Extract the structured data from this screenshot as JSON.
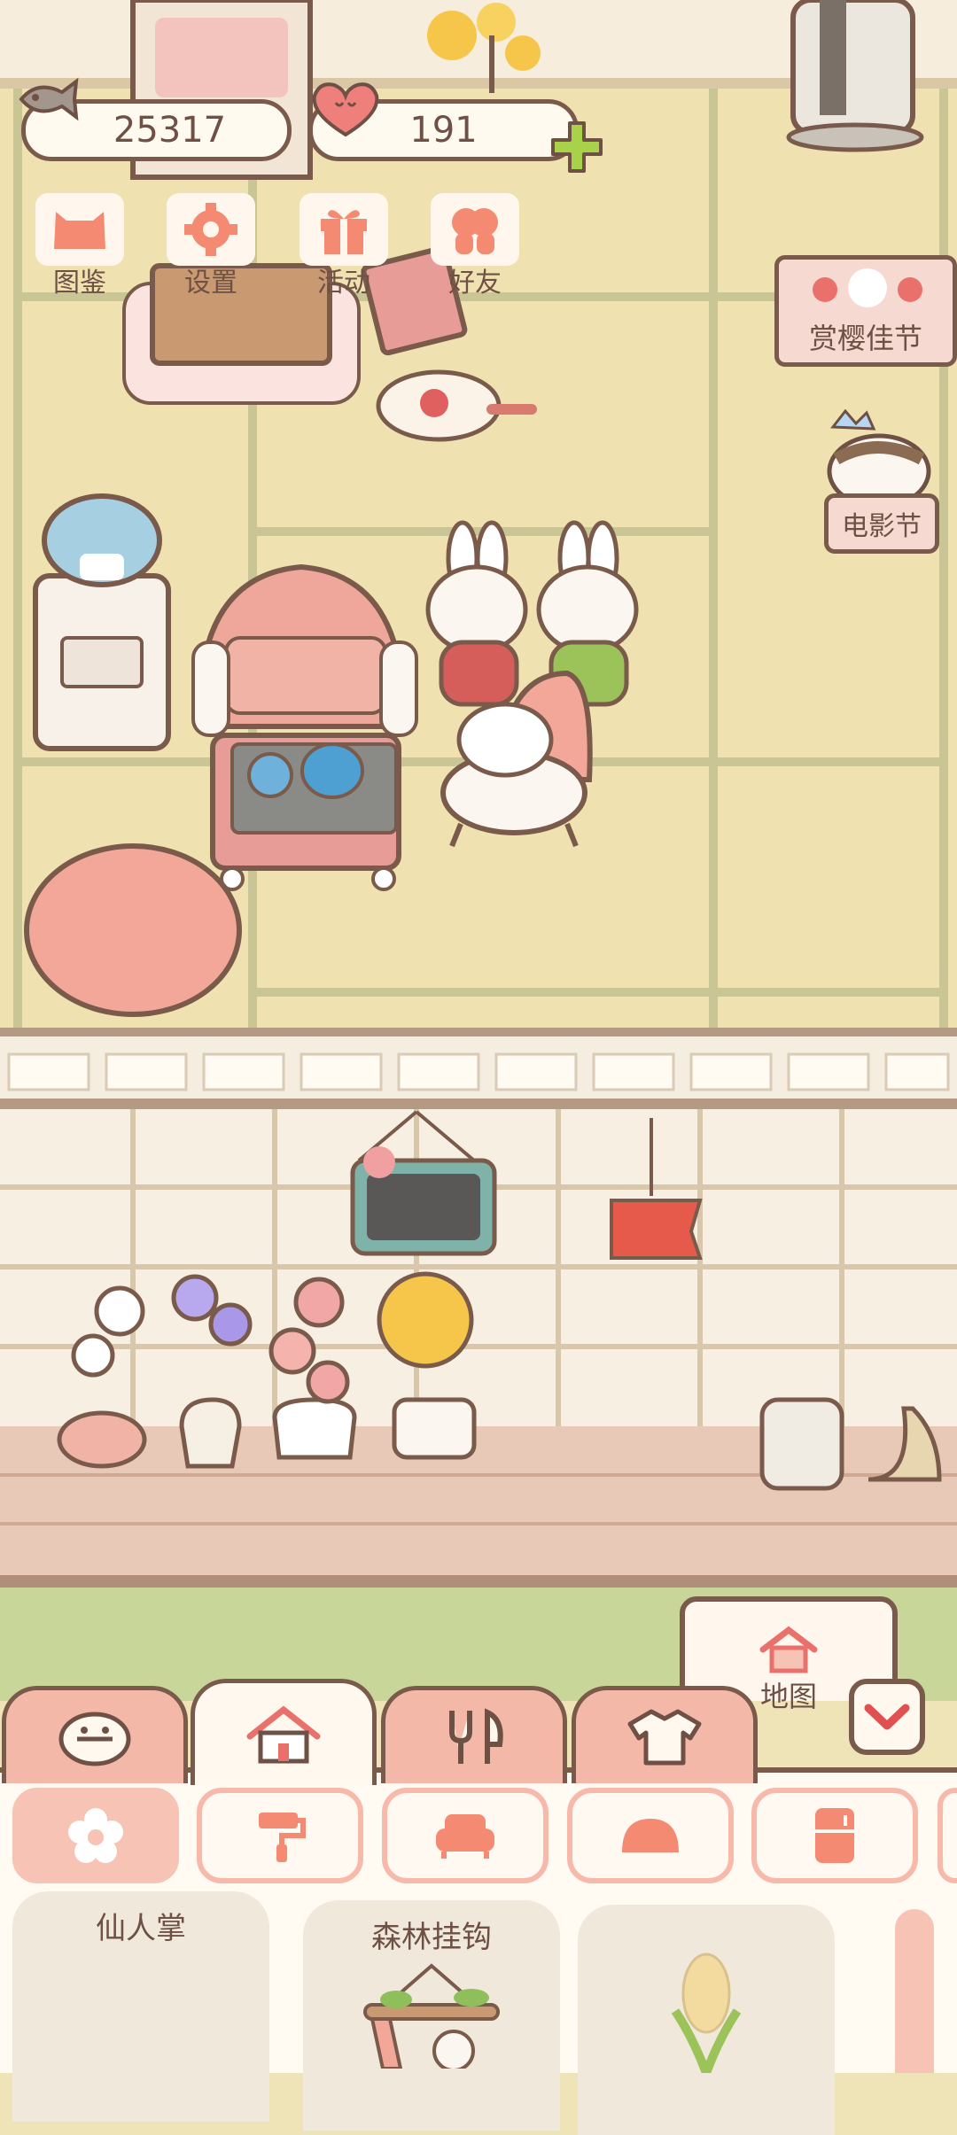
{
  "hud": {
    "fish_count": "25317",
    "heart_count": "191",
    "add_icon": "plus-icon"
  },
  "menu": [
    {
      "label": "图鉴",
      "icon": "cat-book-icon"
    },
    {
      "label": "设置",
      "icon": "gear-icon"
    },
    {
      "label": "活动",
      "icon": "gift-icon"
    },
    {
      "label": "好友",
      "icon": "friends-icon"
    }
  ],
  "events": {
    "sakura": "赏樱佳节",
    "movie": "电影节"
  },
  "map_sign": {
    "label": "地图"
  },
  "tabs": [
    {
      "name": "cat",
      "icon": "cat-face-icon"
    },
    {
      "name": "home",
      "icon": "house-icon",
      "active": true
    },
    {
      "name": "food",
      "icon": "fork-knife-icon"
    },
    {
      "name": "clothes",
      "icon": "shirt-icon"
    }
  ],
  "categories": [
    {
      "icon": "flower-icon",
      "active": true
    },
    {
      "icon": "paint-roller-icon"
    },
    {
      "icon": "sofa-icon"
    },
    {
      "icon": "rug-icon"
    },
    {
      "icon": "fridge-icon"
    }
  ],
  "items": [
    {
      "name": "仙人掌"
    },
    {
      "name": "森林挂钩"
    },
    {
      "name": ""
    }
  ],
  "colors": {
    "accent": "#f3b8a8",
    "outline": "#7a5a4a",
    "tatami": "#efe1b0",
    "cream": "#fff8ee",
    "green_plus": "#a8d24a",
    "collapse_red": "#e05050"
  }
}
